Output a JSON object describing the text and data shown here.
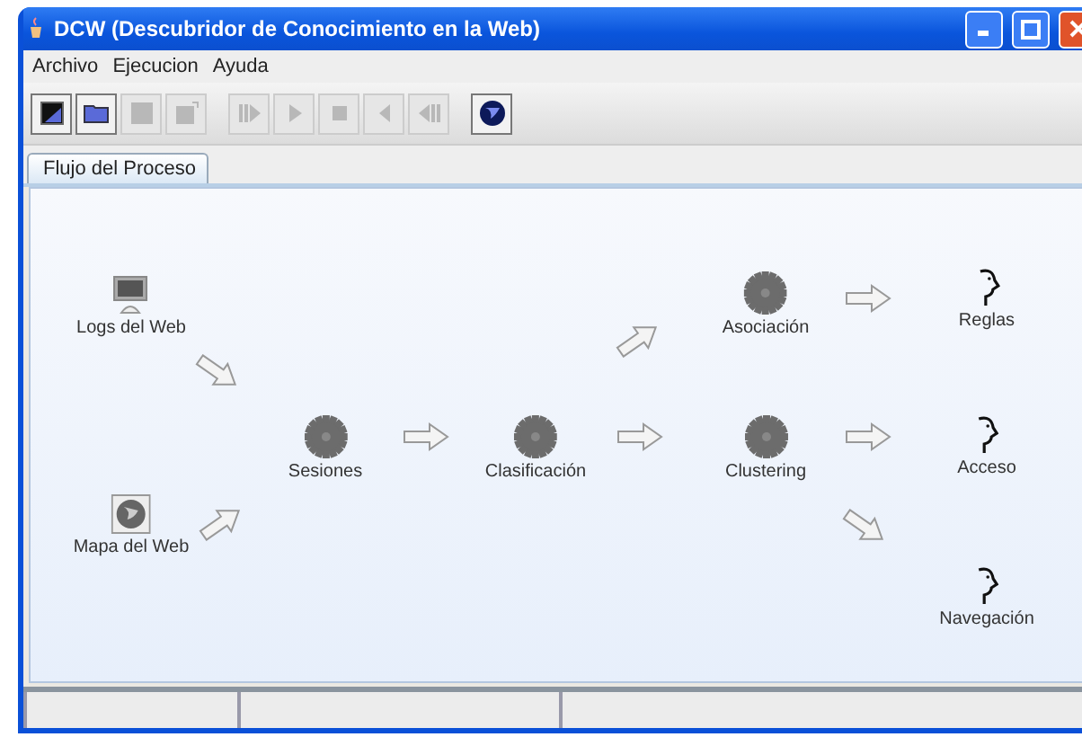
{
  "window": {
    "title": "DCW (Descubridor de Conocimiento en la Web)"
  },
  "menu": [
    "Archivo",
    "Ejecucion",
    "Ayuda"
  ],
  "toolbar": [
    {
      "kind": "new",
      "disabled": false
    },
    {
      "kind": "open",
      "disabled": false
    },
    {
      "kind": "save",
      "disabled": true
    },
    {
      "kind": "export",
      "disabled": true
    },
    {
      "kind": "step",
      "disabled": true
    },
    {
      "kind": "play",
      "disabled": true
    },
    {
      "kind": "stop",
      "disabled": true
    },
    {
      "kind": "back",
      "disabled": true
    },
    {
      "kind": "rewind",
      "disabled": true
    },
    {
      "kind": "globe",
      "disabled": false
    }
  ],
  "tabs": [
    {
      "label": "Flujo del Proceso",
      "selected": true
    }
  ],
  "nodes": [
    {
      "kind": "monitor",
      "label": "Logs del Web"
    },
    {
      "kind": "globe",
      "label": "Mapa del Web"
    },
    {
      "kind": "gear",
      "label": "Sesiones"
    },
    {
      "kind": "gear",
      "label": "Clasificación"
    },
    {
      "kind": "gear",
      "label": "Asociación"
    },
    {
      "kind": "gear",
      "label": "Clustering"
    },
    {
      "kind": "head",
      "label": "Reglas"
    },
    {
      "kind": "head",
      "label": "Acceso"
    },
    {
      "kind": "head",
      "label": "Navegación"
    }
  ],
  "arrows": [
    {
      "kind": "down"
    },
    {
      "kind": "up"
    },
    {
      "kind": "flat"
    },
    {
      "kind": "flat"
    },
    {
      "kind": "up"
    },
    {
      "kind": "flat"
    },
    {
      "kind": "flat"
    },
    {
      "kind": "down"
    }
  ]
}
